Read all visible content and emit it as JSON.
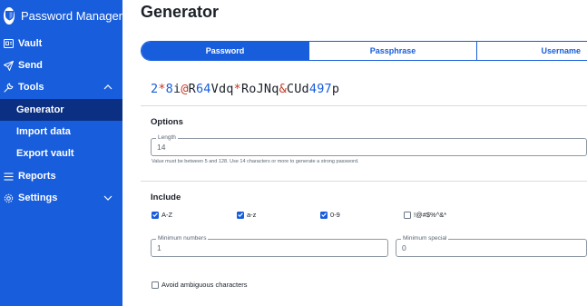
{
  "sidebar": {
    "brand_icon": "shield-icon",
    "brand_name": "Password Manager",
    "accent_color": "#175ddc",
    "active_color": "#0a2f83",
    "items": [
      {
        "label": "Vault",
        "icon": "vault-icon"
      },
      {
        "label": "Send",
        "icon": "send-icon"
      },
      {
        "label": "Tools",
        "icon": "wrench-icon",
        "expanded": true
      },
      {
        "label": "Reports",
        "icon": "reports-icon"
      },
      {
        "label": "Settings",
        "icon": "gear-icon",
        "expanded": false
      }
    ],
    "tools_children": [
      "Generator",
      "Import data",
      "Export vault"
    ],
    "active_item": "Generator"
  },
  "main": {
    "title": "Generator",
    "tabs": [
      "Password",
      "Passphrase",
      "Username"
    ],
    "selected_tab": "Password",
    "generated": {
      "full": "2*8i@R64Vdq*RoJNq&CUd497p",
      "parts": [
        {
          "t": "2",
          "k": "num"
        },
        {
          "t": "*",
          "k": "spec"
        },
        {
          "t": "8",
          "k": "num"
        },
        {
          "t": "i",
          "k": "let"
        },
        {
          "t": "@",
          "k": "spec"
        },
        {
          "t": "R",
          "k": "let"
        },
        {
          "t": "64",
          "k": "num"
        },
        {
          "t": "Vdq",
          "k": "let"
        },
        {
          "t": "*",
          "k": "spec"
        },
        {
          "t": "RoJNq",
          "k": "let"
        },
        {
          "t": "&",
          "k": "spec"
        },
        {
          "t": "CUd",
          "k": "let"
        },
        {
          "t": "497",
          "k": "num"
        },
        {
          "t": "p",
          "k": "let"
        }
      ]
    },
    "options": {
      "title": "Options",
      "length_label": "Length",
      "length_value": "14",
      "hint": "Value must be between 5 and 128. Use 14 characters or more to generate a strong password."
    },
    "include": {
      "title": "Include",
      "checks": [
        {
          "label": "A-Z",
          "checked": true
        },
        {
          "label": "a-z",
          "checked": true
        },
        {
          "label": "0-9",
          "checked": true
        },
        {
          "label": "!@#$%^&*",
          "checked": false
        }
      ],
      "min_numbers_label": "Minimum numbers",
      "min_numbers_value": "1",
      "min_special_label": "Minimum special",
      "min_special_value": "0",
      "avoid_ambiguous": {
        "label": "Avoid ambiguous characters",
        "checked": false
      }
    }
  }
}
